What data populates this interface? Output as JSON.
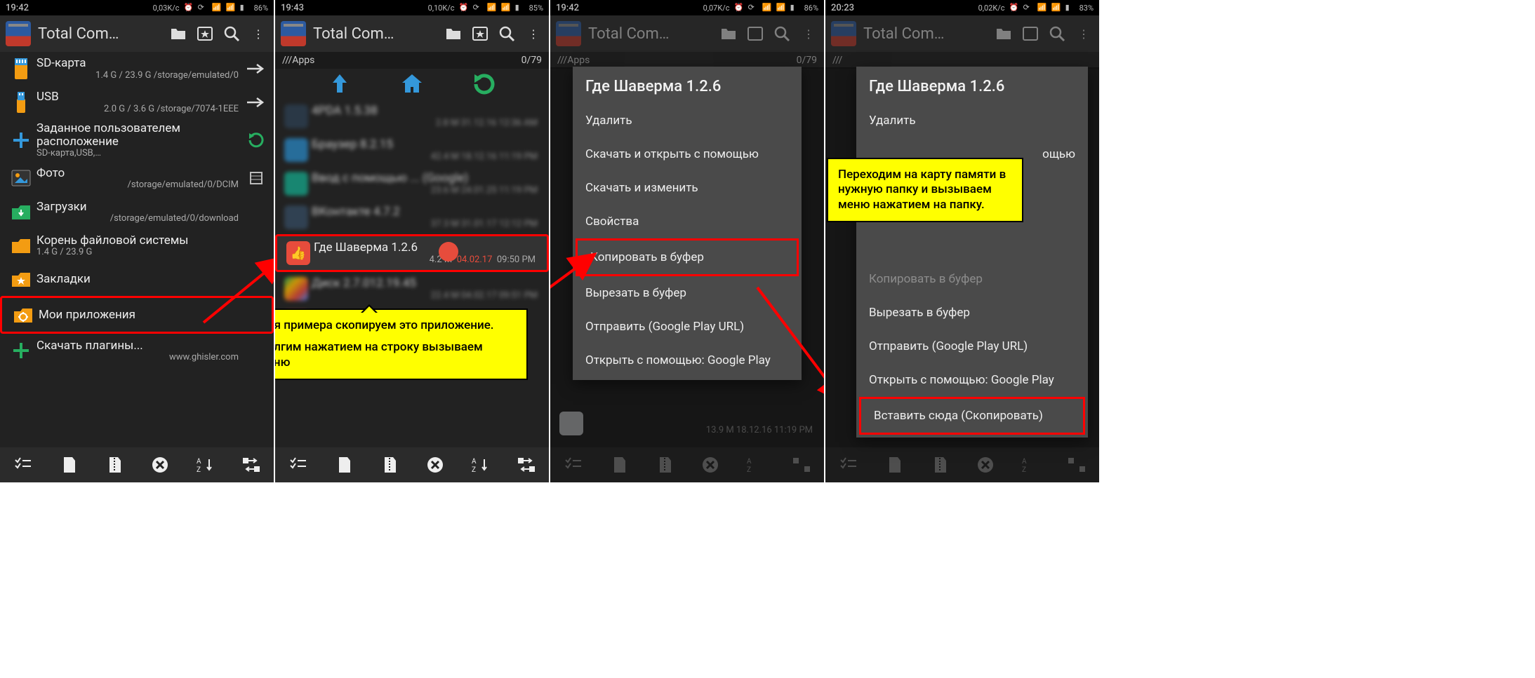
{
  "app_title": "Total Com…",
  "panels": {
    "p1": {
      "status": {
        "time": "19:42",
        "speed": "0,03K/c",
        "battery": "86%"
      },
      "rows": {
        "sd": {
          "title": "SD-карта",
          "sub": "1.4 G / 23.9 G   /storage/emulated/0"
        },
        "usb": {
          "title": "USB",
          "sub": "2.0 G / 3.6 G   /storage/7074-1EEE"
        },
        "custom": {
          "title": "Заданное пользователем расположение",
          "sub": "SD-карта,USB,…"
        },
        "photo": {
          "title": "Фото",
          "sub": "/storage/emulated/0/DCIM"
        },
        "downloads": {
          "title": "Загрузки",
          "sub": "/storage/emulated/0/download"
        },
        "fsroot": {
          "title": "Корень файловой системы",
          "sub": "1.4 G / 23.9 G"
        },
        "bookmarks": {
          "title": "Закладки"
        },
        "myapps": {
          "title": "Мои приложения"
        },
        "plugins": {
          "title": "Скачать плагины...",
          "sub": "www.ghisler.com"
        }
      }
    },
    "p2": {
      "status": {
        "time": "19:43",
        "speed": "0,10K/c",
        "battery": "85%"
      },
      "path": {
        "left": "///Apps",
        "right": "0/79"
      },
      "target": {
        "title": "Где Шаверма  1.2.6",
        "size": "4.2 M",
        "date": "04.02.17",
        "time": "09:50 PM"
      },
      "callout_line1": "Для примера скопируем это приложение.",
      "callout_line2": "Долгим нажатием на строку вызываем меню"
    },
    "p3": {
      "status": {
        "time": "19:42",
        "speed": "0,07K/c",
        "battery": "86%"
      },
      "path": {
        "left": "///Apps",
        "right": "0/79"
      },
      "peek": {
        "sub": "13.9 M   18.12.16   11:19 PM"
      },
      "menu": {
        "title": "Где Шаверма  1.2.6",
        "items": {
          "delete": "Удалить",
          "download_open": "Скачать и открыть с помощью",
          "download_edit": "Скачать и изменить",
          "props": "Свойства",
          "copy": "Копировать в буфер",
          "cut": "Вырезать в буфер",
          "send": "Отправить (Google Play URL)",
          "open_with": "Открыть с помощью: Google Play"
        }
      }
    },
    "p4": {
      "status": {
        "time": "20:23",
        "speed": "0,02K/c",
        "battery": "83%"
      },
      "callout": "Переходим на карту памяти в нужную папку и вызываем меню нажатием на папку.",
      "menu": {
        "title": "Где Шаверма  1.2.6",
        "items": {
          "delete": "Удалить",
          "open_partial": "ощью",
          "copy_partial": "Копировать в буфер",
          "cut": "Вырезать в буфер",
          "send": "Отправить (Google Play URL)",
          "open_with": "Открыть с помощью: Google Play",
          "paste": "Вставить сюда (Скопировать)"
        }
      }
    }
  }
}
